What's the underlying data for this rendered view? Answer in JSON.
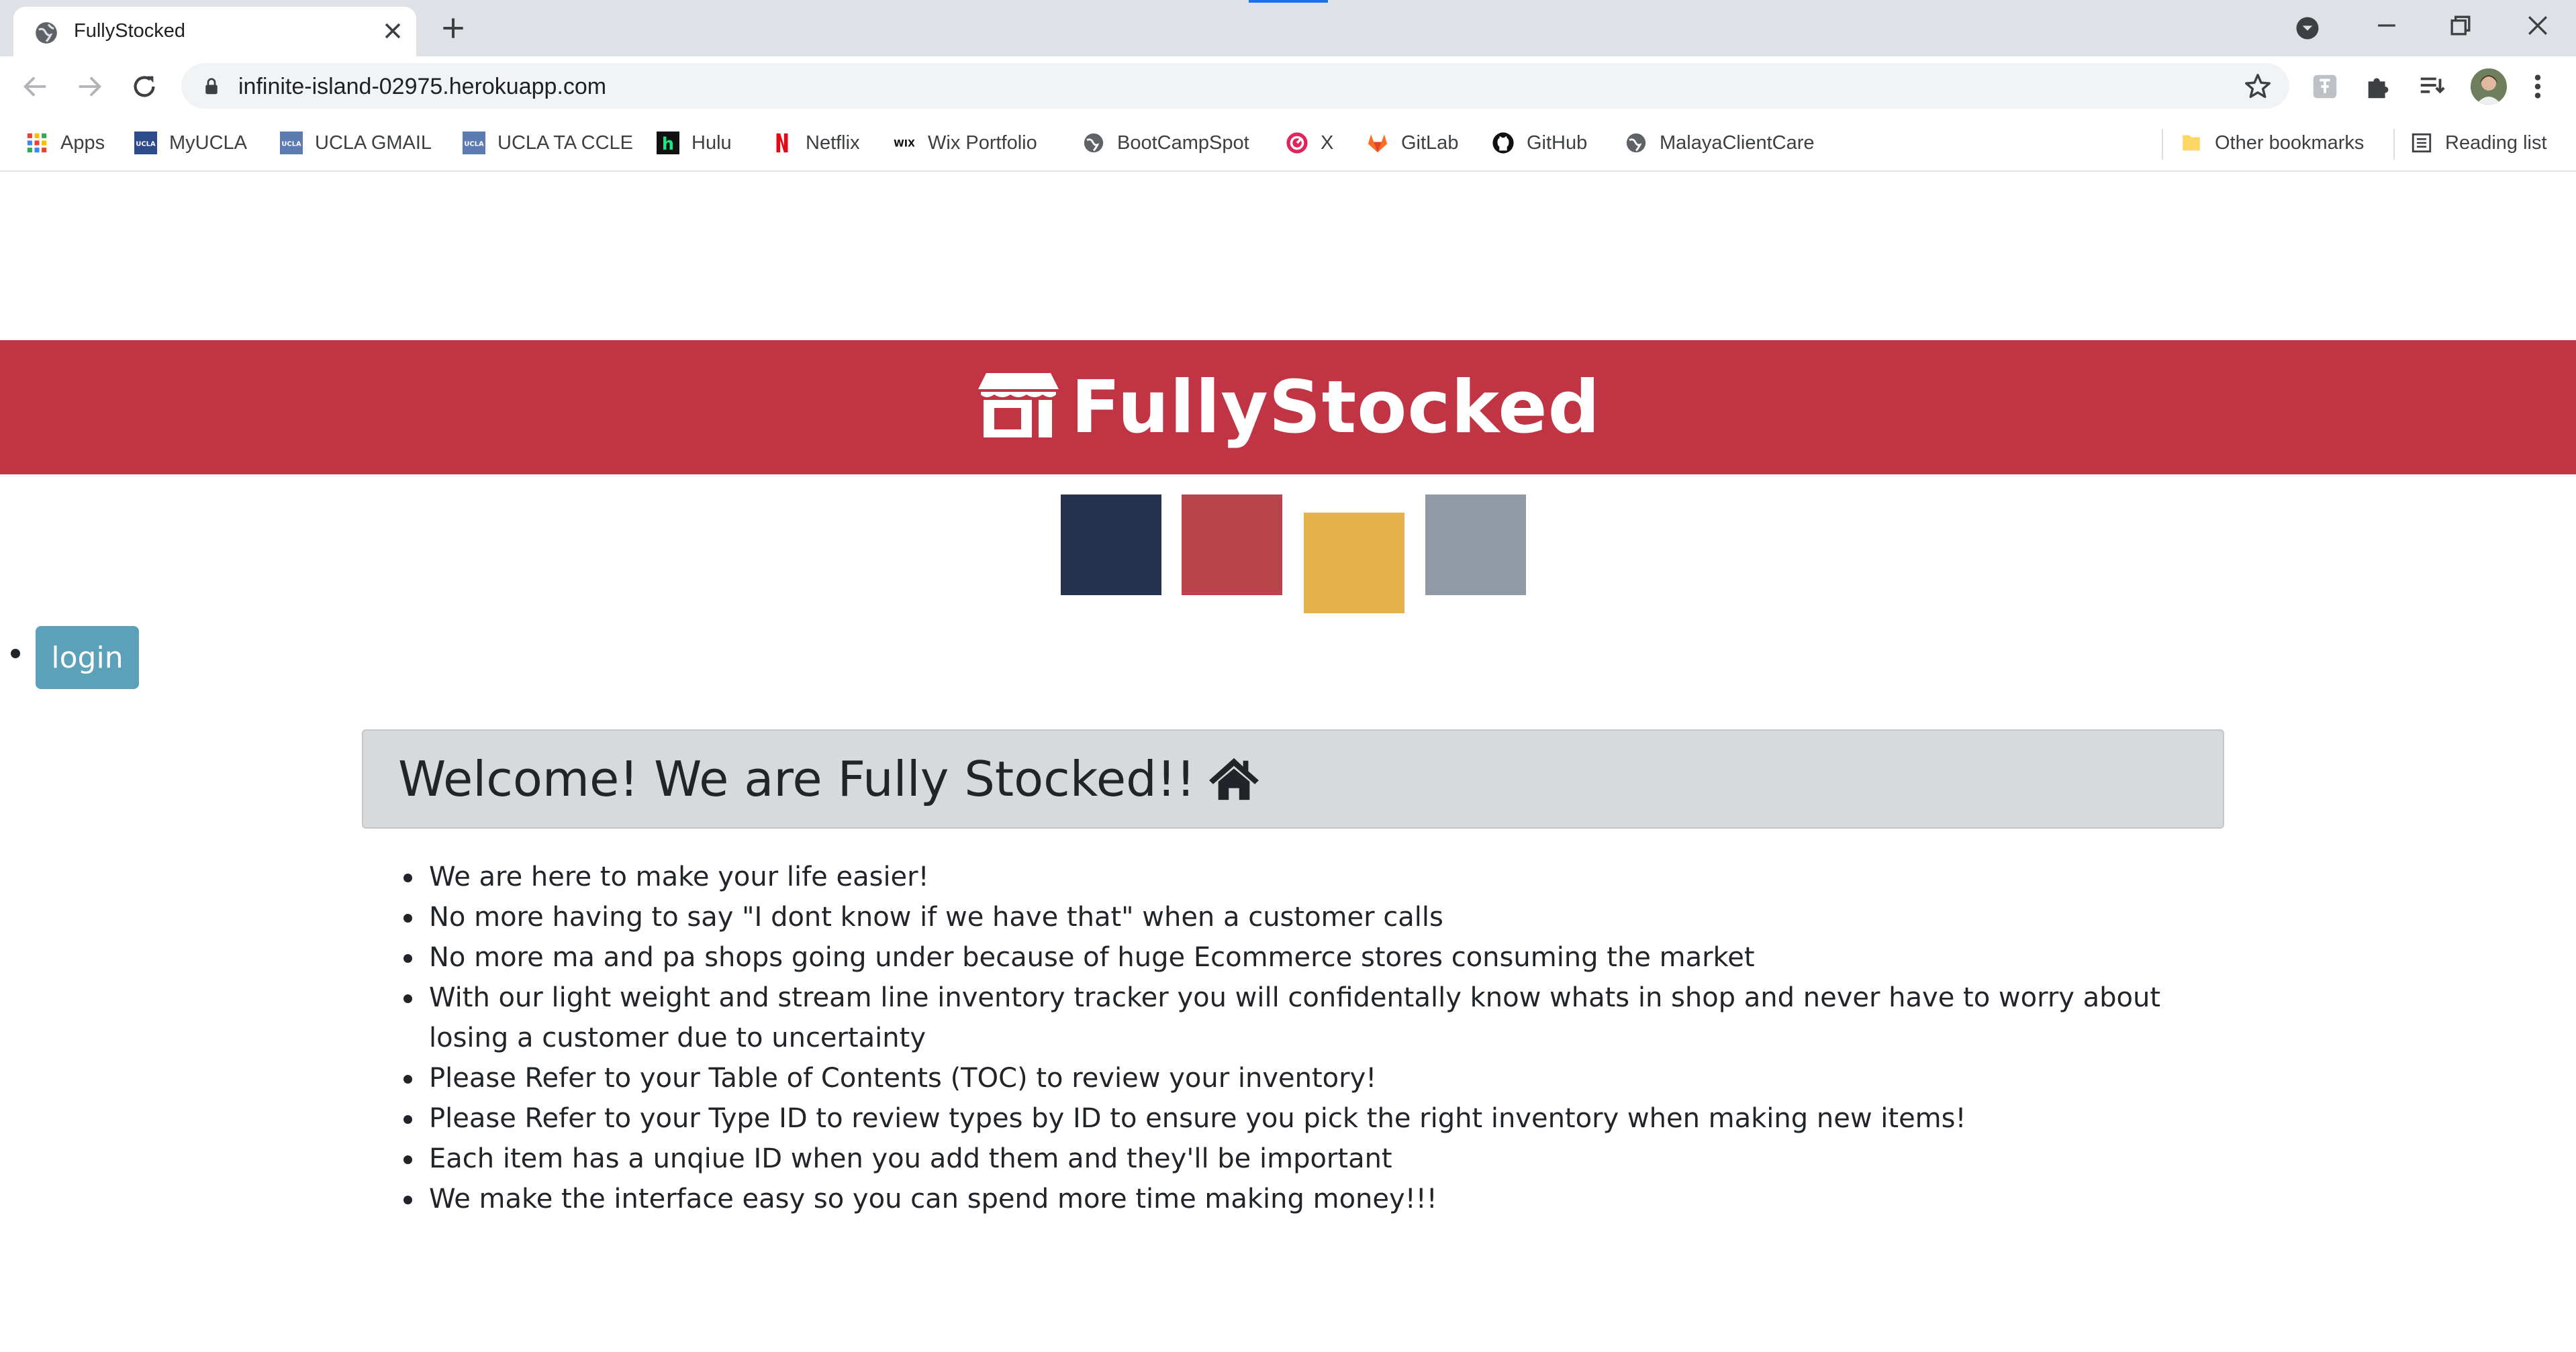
{
  "browser": {
    "tab_title": "FullyStocked",
    "url": "infinite-island-02975.herokuapp.com",
    "bookmarks": [
      {
        "label": "Apps",
        "icon": "apps-grid-icon"
      },
      {
        "label": "MyUCLA",
        "icon": "ucla-icon"
      },
      {
        "label": "UCLA GMAIL",
        "icon": "ucla-icon"
      },
      {
        "label": "UCLA TA CCLE",
        "icon": "ucla-icon"
      },
      {
        "label": "Hulu",
        "icon": "hulu-icon"
      },
      {
        "label": "Netflix",
        "icon": "netflix-icon"
      },
      {
        "label": "Wix Portfolio",
        "icon": "wix-icon"
      },
      {
        "label": "BootCampSpot",
        "icon": "globe-icon"
      },
      {
        "label": "X",
        "icon": "x-app-icon"
      },
      {
        "label": "GitLab",
        "icon": "gitlab-icon"
      },
      {
        "label": "GitHub",
        "icon": "github-icon"
      },
      {
        "label": "MalayaClientCare",
        "icon": "globe-icon"
      }
    ],
    "other_bookmarks": "Other bookmarks",
    "reading_list": "Reading list"
  },
  "header": {
    "brand": "FullyStocked",
    "brand_color": "#c13444"
  },
  "palette": [
    "#243250",
    "#b9434b",
    "#e5b14b",
    "#8f9aa6"
  ],
  "nav": {
    "login_label": "login"
  },
  "main": {
    "welcome_title": "Welcome! We are Fully Stocked!!",
    "features": [
      "We are here to make your life easier!",
      "No more having to say \"I dont know if we have that\" when a customer calls",
      "No more ma and pa shops going under because of huge Ecommerce stores consuming the market",
      "With our light weight and stream line inventory tracker you will confidentally know whats in shop and never have to worry about losing a customer due to uncertainty",
      "Please Refer to your Table of Contents (TOC) to review your inventory!",
      "Please Refer to your Type ID to review types by ID to ensure you pick the right inventory when making new items!",
      "Each item has a unqiue ID when you add them and they'll be important",
      "We make the interface easy so you can spend more time making money!!!"
    ]
  }
}
